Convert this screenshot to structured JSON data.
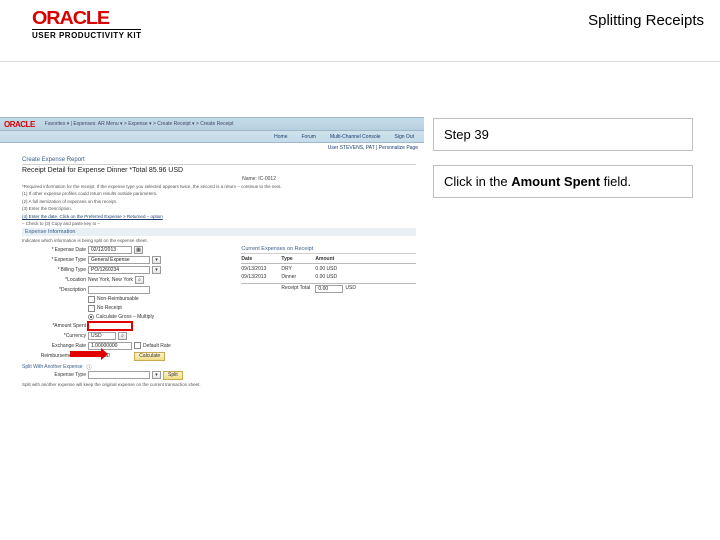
{
  "header": {
    "logo": "ORACLE",
    "sublogo": "USER PRODUCTIVITY KIT",
    "title": "Splitting Receipts"
  },
  "right_panel": {
    "step_label": "Step 39",
    "instruction_prefix": "Click in the ",
    "instruction_bold": "Amount Spent",
    "instruction_suffix": " field."
  },
  "screenshot": {
    "crumbs": "Favorites ▾   | Expenses: AR Menu ▾  > Expense ▾  > Create Receipt ▾  > Create Receipt",
    "tabs": [
      "Home",
      "Forum",
      "Multi-Channel Console",
      "Sign Out"
    ],
    "userline": "User STEVENS, PAT | Personalize Page",
    "breadcrumb_title": "Create Expense Report",
    "page_title": "Receipt Detail for Expense Dinner *Total 85.96 USD",
    "name_line": "Name: IC-0012",
    "notes": [
      "*Required information for the receipt. If the expense type you selected appears twice, the second is a return – continue to the next.",
      "(1) If other expense profiles could return results outside parameters.",
      "(2) A full itemization of expenses on this receipt.",
      "(3) Enter the Description.",
      "(4) Enter the date. Click on the Preferred Expense > Returned – option",
      "– Check to (3) Copy and paste key to –"
    ],
    "section_heading": "Expense Information",
    "tip_text": "Indicates which information is being split on the expense sheet.",
    "form": {
      "expense_date": {
        "label": "Expense Date",
        "value": "02/12/2013"
      },
      "expense_type": {
        "label": "Expense Type",
        "value": "General Expense"
      },
      "billing_type": {
        "label": "Billing Type",
        "value": "PO/1260234"
      },
      "location": {
        "label": "*Location",
        "value": "New York, New York"
      },
      "description": {
        "label": "*Description",
        "value": ""
      },
      "non_reimb": "Non-Reimbursable",
      "no_receipt": "No Receipt",
      "calc_multiply": "Calculate Gross – Multiply",
      "amount_spent": {
        "label": "*Amount Spent",
        "value": ""
      },
      "currency": {
        "label": "*Currency",
        "value": "USD"
      },
      "exchange_rate": {
        "label": "Exchange Rate",
        "value": "1.00000000"
      },
      "default_rate": "Default Rate",
      "reimb_amt": {
        "label": "Reimbursement Amt",
        "value": "0.00",
        "curr": "USD"
      }
    },
    "calc_btn": "Calculate",
    "right_subhead": "Current Expenses on Receipt",
    "table": {
      "headers": [
        "Date",
        "Type",
        "Amount"
      ],
      "rows": [
        [
          "09/13/2013",
          "DRY",
          "0.00 USD"
        ],
        [
          "09/13/2013",
          "Dinner",
          "0.00 USD"
        ]
      ],
      "total_label": "Receipt Total",
      "total_input": "0.00",
      "total_curr": "USD"
    },
    "split_label": "Split With Another Expense",
    "split_sub_label": "Expense Type",
    "split_btn": "Split",
    "footer_note": "Split with another expense will keep the original expense on the current transaction sheet."
  }
}
